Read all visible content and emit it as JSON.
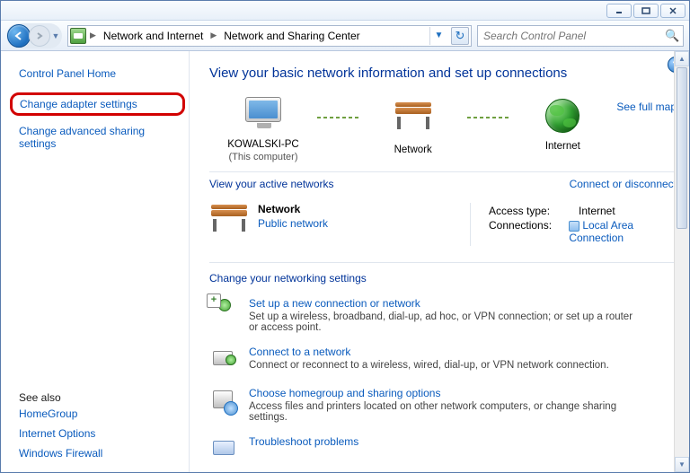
{
  "window": {
    "breadcrumbs": [
      "Network and Internet",
      "Network and Sharing Center"
    ],
    "search_placeholder": "Search Control Panel"
  },
  "sidebar": {
    "home": "Control Panel Home",
    "links": {
      "adapter": "Change adapter settings",
      "advanced": "Change advanced sharing settings"
    },
    "see_also_title": "See also",
    "see_also": {
      "homegroup": "HomeGroup",
      "internet": "Internet Options",
      "firewall": "Windows Firewall"
    }
  },
  "content": {
    "heading": "View your basic network information and set up connections",
    "see_full_map": "See full map",
    "nodes": {
      "pc": {
        "label": "KOWALSKI-PC",
        "sub": "(This computer)"
      },
      "net": {
        "label": "Network"
      },
      "internet": {
        "label": "Internet"
      }
    },
    "active_networks_label": "View your active networks",
    "connect_disconnect": "Connect or disconnect",
    "network_card": {
      "name": "Network",
      "type": "Public network",
      "access_label": "Access type:",
      "access_value": "Internet",
      "conn_label": "Connections:",
      "conn_value": "Local Area Connection"
    },
    "change_settings_title": "Change your networking settings",
    "settings": {
      "s1": {
        "title": "Set up a new connection or network",
        "desc": "Set up a wireless, broadband, dial-up, ad hoc, or VPN connection; or set up a router or access point."
      },
      "s2": {
        "title": "Connect to a network",
        "desc": "Connect or reconnect to a wireless, wired, dial-up, or VPN network connection."
      },
      "s3": {
        "title": "Choose homegroup and sharing options",
        "desc": "Access files and printers located on other network computers, or change sharing settings."
      },
      "s4": {
        "title": "Troubleshoot problems",
        "desc": ""
      }
    }
  }
}
